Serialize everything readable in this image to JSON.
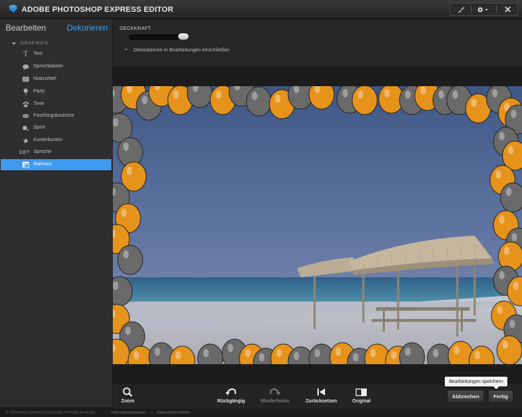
{
  "app": {
    "title": "ADOBE PHOTOSHOP EXPRESS EDITOR",
    "toolbar_icons": [
      "brush-icon",
      "gear-icon",
      "close-icon"
    ]
  },
  "sidebar": {
    "tab_edit": "Bearbeiten",
    "tab_decorate": "Dekorieren",
    "section": "GRAFIKEN",
    "items": [
      {
        "label": "Text",
        "icon": "text-icon"
      },
      {
        "label": "Sprechblasen",
        "icon": "speech-bubble-icon"
      },
      {
        "label": "Notizzettel",
        "icon": "note-icon"
      },
      {
        "label": "Party",
        "icon": "party-icon"
      },
      {
        "label": "Tiere",
        "icon": "paw-icon"
      },
      {
        "label": "Faschingskostüme",
        "icon": "mask-icon"
      },
      {
        "label": "Sport",
        "icon": "sport-icon"
      },
      {
        "label": "Kunterbuntes",
        "icon": "misc-icon"
      },
      {
        "label": "Sprüche",
        "icon": "quote-icon"
      },
      {
        "label": "Rahmen",
        "icon": "frame-icon",
        "active": true
      }
    ]
  },
  "options": {
    "opacity_label": "DECKKRAFT",
    "opacity_value": 1.0,
    "include_label": "Dekorationen in Bearbeitungen einschließen"
  },
  "toolbar": {
    "zoom": "Zoom",
    "undo": "Rückgängig",
    "redo": "Wiederholen",
    "reset": "Zurücksetzen",
    "original": "Original",
    "cancel": "Abbrechen",
    "done": "Fertig",
    "tooltip": "Bearbeitungen speichern"
  },
  "footer": {
    "copyright": "© 2010 Adobe Systems Incorporated. All Rights Reserved.",
    "terms": "Nutzungsbedingungen",
    "divider": "|",
    "privacy": "Datenschutzrichtlinien"
  },
  "colors": {
    "accent": "#3f9bf0",
    "balloon_orange": "#e6931c",
    "balloon_gray": "#6a6a6a"
  }
}
